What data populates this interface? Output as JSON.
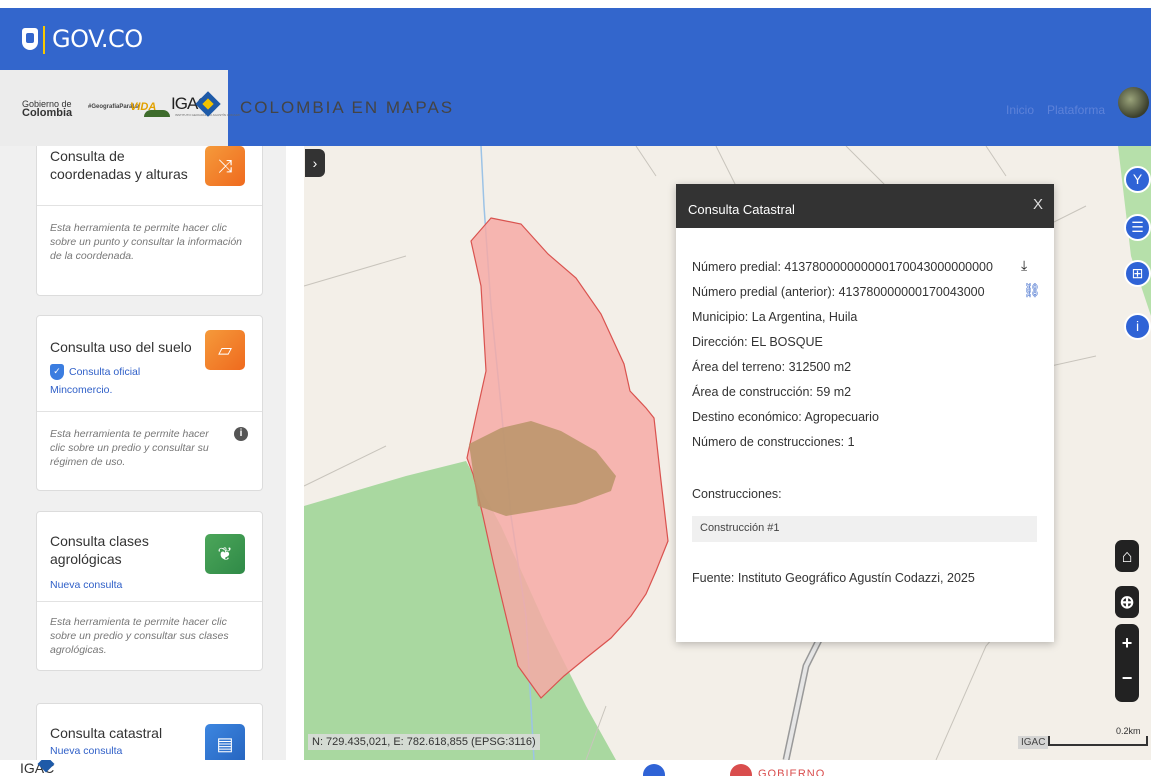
{
  "govbar": {
    "label": "GOV.CO"
  },
  "header": {
    "logo_gobierno_line1": "Gobierno de",
    "logo_gobierno_line2": "Colombia",
    "logo_geografia": "#GeografíaParaLa",
    "logo_vida": "VIDA",
    "logo_igac": "IGAC",
    "logo_igac_sub": "INSTITUTO GEOGRÁFICO AGUSTÍN CODAZZI",
    "title": "COLOMBIA EN MAPAS",
    "nav": [
      "Inicio",
      "Plataforma"
    ]
  },
  "sidebar": {
    "cards": [
      {
        "title": "Consulta de coordenadas y alturas",
        "description": "Esta herramienta te permite hacer clic sobre un punto y consultar la información de la coordenada.",
        "icon": "arrows-icon"
      },
      {
        "title": "Consulta uso del suelo",
        "badge": "Consulta oficial",
        "link": "Mincomercio.",
        "description": "Esta herramienta te permite hacer clic sobre un predio y consultar su régimen de uso.",
        "icon": "parcel-icon"
      },
      {
        "title": "Consulta clases agrológicas",
        "link": "Nueva consulta",
        "description": "Esta herramienta te permite hacer clic sobre un predio y consultar sus clases agrológicas.",
        "icon": "plant-icon"
      },
      {
        "title": "Consulta catastral",
        "link": "Nueva consulta",
        "icon": "cadastre-icon"
      }
    ]
  },
  "map": {
    "coords": "N: 729.435,021, E: 782.618,855 (EPSG:3116)",
    "attribution": "IGAC",
    "scale": "0.2km",
    "zoom_in": "+",
    "zoom_out": "−"
  },
  "popup": {
    "title": "Consulta Catastral",
    "close": "X",
    "fields": [
      "Número predial: 413780000000000170043000000000",
      "Número predial (anterior): 413780000000170043000",
      "Municipio: La Argentina, Huila",
      "Dirección: EL BOSQUE",
      "Área del terreno: 312500 m2",
      "Área de construcción: 59 m2",
      "Destino económico: Agropecuario",
      "Número de construcciones: 1"
    ],
    "constructions_label": "Construcciones:",
    "construction_item": "Construcción #1",
    "source": "Fuente: Instituto Geográfico Agustín Codazzi, 2025"
  },
  "footer": {
    "igac": "IGAC",
    "gobierno": "GOBIERNO"
  },
  "colors": {
    "primary": "#3366cc",
    "parcel_fill": "#f6aaa6",
    "parcel_stroke": "#d9534f",
    "forest": "#a9d8a0",
    "soil": "#b89468"
  }
}
